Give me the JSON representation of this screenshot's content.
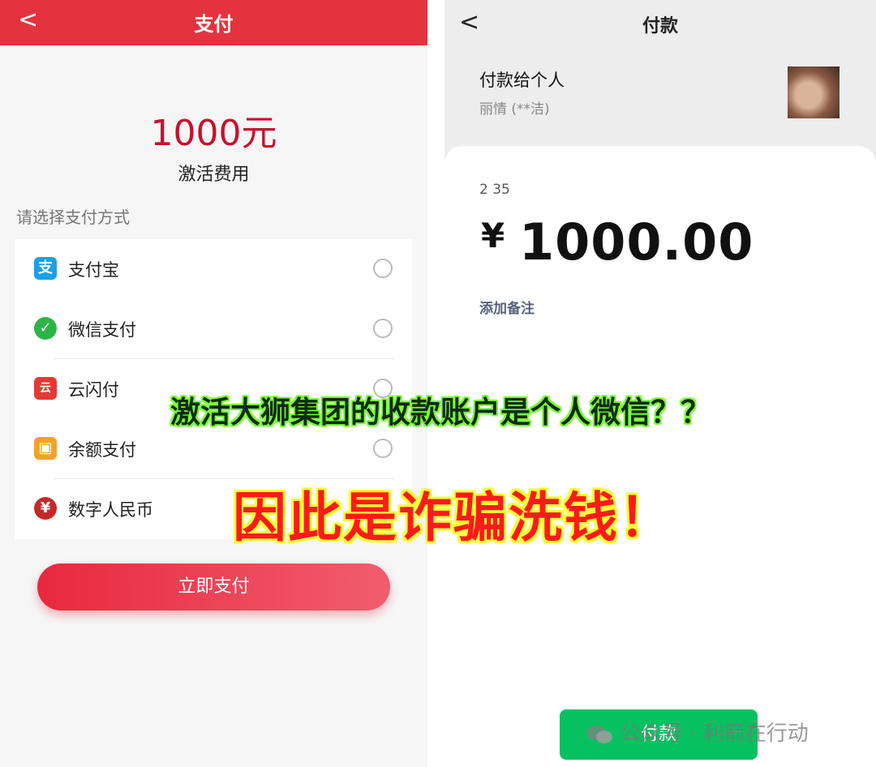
{
  "left_screen": {
    "header": {
      "back_glyph": "<",
      "title": "支付"
    },
    "amount": "1000元",
    "fee_label": "激活费用",
    "prompt": "请选择支付方式",
    "options": [
      {
        "label": "支付宝",
        "icon": "alipay-icon",
        "icon_glyph": "支",
        "color": "#1aa0e8"
      },
      {
        "label": "微信支付",
        "icon": "wechat-pay-icon",
        "icon_glyph": "✓",
        "color": "#2cb547"
      },
      {
        "label": "云闪付",
        "icon": "unionpay-quickpass-icon",
        "icon_glyph": "云",
        "color": "#e53935"
      },
      {
        "label": "余额支付",
        "icon": "gift-balance-icon",
        "icon_glyph": "▣",
        "color": "#f2a12b"
      },
      {
        "label": "数字人民币",
        "icon": "digital-rmb-icon",
        "icon_glyph": "¥",
        "color": "#c62828"
      }
    ],
    "pay_button": "立即支付"
  },
  "right_screen": {
    "header": {
      "back_glyph": "<",
      "title": "付款"
    },
    "payee_title": "付款给个人",
    "payee_name": "丽情 (**洁)",
    "account_partial": "2 35",
    "currency_symbol": "¥",
    "amount": "1000.00",
    "add_remark": "添加备注",
    "pay_button": "付款"
  },
  "overlay": {
    "line1": "激活大狮集团的收款账户是个人微信？？",
    "line2": "因此是诈骗洗钱！"
  },
  "watermark": "公众号 · 利箭在行动",
  "colors": {
    "left_header": "#e4333f",
    "amount_red": "#c8102e",
    "wechat_green": "#07c160"
  }
}
